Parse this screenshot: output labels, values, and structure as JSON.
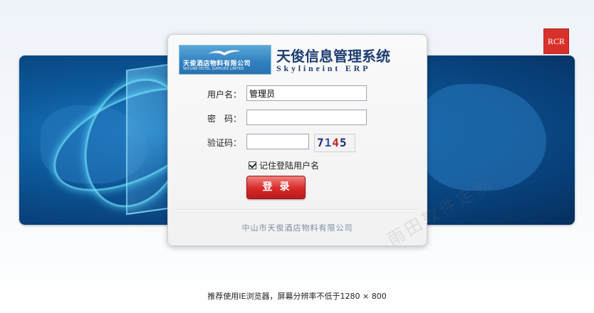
{
  "brand": {
    "logo_cn": "天俊酒店物料有限公司",
    "logo_en": "SKYLINE HOTEL SUPPLIES LIMITED",
    "title": "天俊信息管理系统",
    "subtitle": "Skylineint ERP",
    "partner_logo": "RCR"
  },
  "form": {
    "username_label": "用户名：",
    "username_value": "管理员",
    "password_label": "密　码：",
    "password_value": "",
    "captcha_label": "验证码：",
    "captcha_value": "",
    "captcha_digits": [
      "7",
      "1",
      "4",
      "5"
    ],
    "remember_label": "记住登陆用户名",
    "remember_checked": true,
    "login_button": "登录"
  },
  "company_name": "中山市天俊酒店物料有限公司",
  "watermark": "雨田软件定制",
  "footer_note": "推荐使用IE浏览器，屏幕分辨率不低于1280 × 800",
  "colors": {
    "banner": "#0d5a9c",
    "button": "#d72a28",
    "title": "#1f3f72",
    "partner_logo_bg": "#d8312b"
  }
}
